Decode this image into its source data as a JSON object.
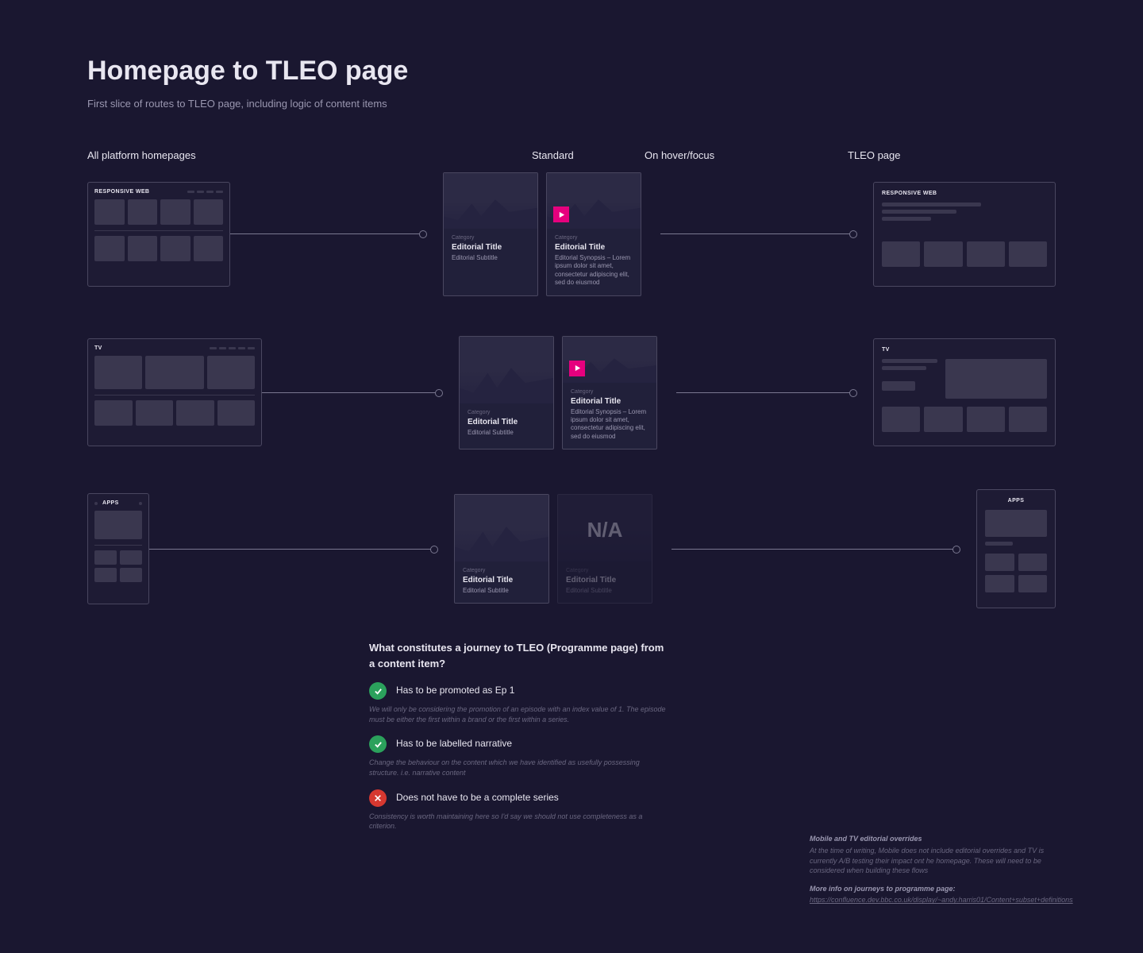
{
  "header": {
    "title": "Homepage to TLEO page",
    "subtitle": "First slice of routes to TLEO page, including logic of content items"
  },
  "columns": {
    "homepages": "All platform homepages",
    "standard": "Standard",
    "hover": "On hover/focus",
    "tleo": "TLEO page"
  },
  "platforms": {
    "web": "RESPONSIVE WEB",
    "tv": "TV",
    "apps": "APPS"
  },
  "card": {
    "category": "Category",
    "title": "Editorial Title",
    "subtitle": "Editorial Subtitle",
    "synopsis_short": "Editorial Synopsis – Lorem ipsum dolor sit amet, consectetur adipiscing elit, sed do eiusmod",
    "synopsis_long": "Editorial Synopsis – Lorem ipsum dolor sit amet, consectetur adipiscing elit, sed do eiusmod",
    "na": "N/A"
  },
  "rules": {
    "heading": "What constitutes a journey to TLEO (Programme page) from a content item?",
    "items": [
      {
        "ok": true,
        "text": "Has to be promoted as Ep 1",
        "note": "We will only be considering the promotion of an episode with an index value of 1. The episode must be either the first within a brand or the first within a series."
      },
      {
        "ok": true,
        "text": "Has to be labelled narrative",
        "note": "Change the behaviour on the content which we have identified as usefully possessing structure. i.e. narrative content"
      },
      {
        "ok": false,
        "text": "Does not have to be a complete series",
        "note": "Consistency is worth maintaining here so I'd say we should not use completeness as a criterion."
      }
    ]
  },
  "footnotes": {
    "title1": "Mobile and TV editorial overrides",
    "body1": "At the time of writing, Mobile does not include editorial overrides and TV is currently A/B testing their impact ont he homepage. These will need to be considered when building these flows",
    "title2": "More info on journeys to programme page:",
    "link": "https://confluence.dev.bbc.co.uk/display/~andy.harris01/Content+subset+definitions"
  }
}
